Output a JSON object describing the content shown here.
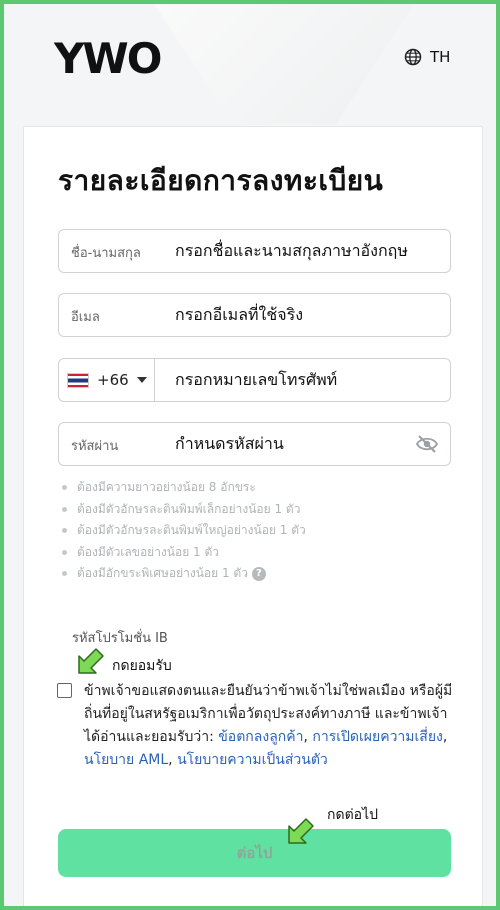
{
  "header": {
    "brand_name": "YWO",
    "lang_label": "TH",
    "lang_icon": "globe-icon"
  },
  "form": {
    "title": "รายละเอียดการลงทะเบียน",
    "name_label": "ชื่อ-นามสกุล",
    "name_value": "กรอกชื่อและนามสกุลภาษาอังกฤษ",
    "email_label": "อีเมล",
    "email_value": "กรอกอีเมลที่ใช้จริง",
    "phone_code": "+66",
    "phone_value": "กรอกหมายเลขโทรศัพท์",
    "password_label": "รหัสผ่าน",
    "password_value": "กำหนดรหัสผ่าน",
    "password_rules": [
      "ต้องมีความยาวอย่างน้อย 8 อักขระ",
      "ต้องมีตัวอักษรละตินพิมพ์เล็กอย่างน้อย 1 ตัว",
      "ต้องมีตัวอักษรละตินพิมพ์ใหญ่อย่างน้อย 1 ตัว",
      "ต้องมีตัวเลขอย่างน้อย 1 ตัว",
      "ต้องมีอักขระพิเศษอย่างน้อย 1 ตัว"
    ],
    "help_glyph": "?",
    "promo_label": "รหัสโปรโมชั่น IB",
    "consent_text": "ข้าพเจ้าขอแสดงตนและยืนยันว่าข้าพเจ้าไม่ใช่พลเมือง หรือผู้มีถิ่นที่อยู่ในสหรัฐอเมริกาเพื่อวัตถุประสงค์ทางภาษี และข้าพเจ้าได้อ่านและยอมรับว่า: ",
    "consent_links": [
      "ข้อตกลงลูกค้า",
      "การเปิดเผยความเสี่ยง",
      "นโยบาย AML",
      "นโยบายความเป็นส่วนตัว"
    ],
    "consent_seps": [
      ", ",
      ", ",
      ", "
    ],
    "submit_label": "ต่อไป"
  },
  "annotations": {
    "accept_note": "กดยอมรับ",
    "next_note": "กดต่อไป"
  },
  "colors": {
    "frame_border": "#5cc86f",
    "button_bg": "#5fe1a2",
    "link": "#2b62b8",
    "annotation_arrow": "#7ed957"
  }
}
